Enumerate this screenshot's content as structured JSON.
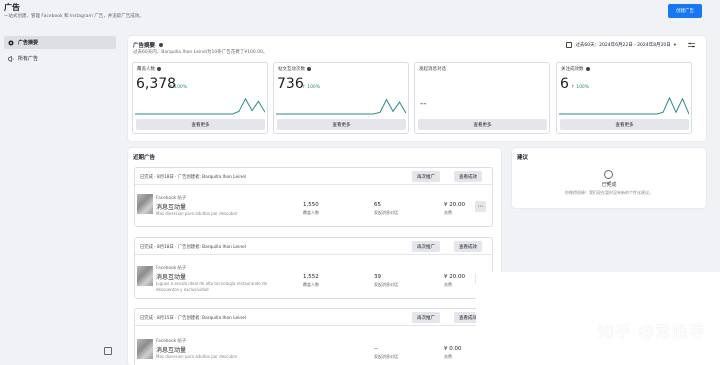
{
  "header": {
    "title": "广告",
    "subtitle": "一站式创建、管理 Facebook 和 Instagram 广告，并追踪广告成效。",
    "create_label": "创建广告"
  },
  "sidebar": {
    "items": [
      {
        "label": "广告摘要",
        "active": true
      },
      {
        "label": "所有广告",
        "active": false
      }
    ]
  },
  "summary": {
    "title": "广告摘要",
    "subtitle": "过去60天内，Barquilla Ihon Leinel为10条广告花费了¥100.00。",
    "date_range": "过去60天：2024年6月22日 - 2024年8月20日",
    "metrics": [
      {
        "label": "覆盖人数",
        "value": "6,378",
        "change": "↑ 100%",
        "button": "查看更多",
        "spark": [
          0,
          0,
          0,
          0,
          0,
          0,
          0,
          0,
          0,
          0,
          0,
          0,
          0,
          0,
          0,
          0,
          0.15,
          0.9,
          0.2,
          0.75,
          0.1
        ]
      },
      {
        "label": "帖文互动次数",
        "value": "736",
        "change": "↑ 100%",
        "button": "查看更多",
        "spark": [
          0,
          0,
          0,
          0,
          0,
          0,
          0,
          0,
          0,
          0,
          0,
          0,
          0,
          0,
          0,
          0,
          0.1,
          0.85,
          0.15,
          0.7,
          0.05
        ]
      },
      {
        "label": "发起消息对话",
        "value": "--",
        "change": "",
        "button": "查看更多",
        "spark": []
      },
      {
        "label": "关注成效数",
        "value": "6",
        "change": "↑ 100%",
        "button": "查看更多",
        "spark": [
          0,
          0,
          0,
          0,
          0,
          0,
          0,
          0,
          0,
          0,
          0,
          0,
          0,
          0,
          0,
          0,
          0.1,
          0.95,
          0.1,
          0.9,
          0.0
        ]
      }
    ]
  },
  "recent": {
    "title": "近期广告",
    "ads": [
      {
        "status": "已完成 · 8月18日 · 广告创建者: Barquilla Ihon Leinel",
        "boost_label": "再次推广",
        "view_label": "查看成效",
        "source": "Facebook 帖子",
        "name": "消息互动量",
        "desc": "Mas diversion para adultos por descubrir",
        "reach": "1,550",
        "reach_label": "覆盖人数",
        "engage": "65",
        "engage_label": "发起消息对话",
        "spend": "¥ 20.00",
        "spend_label": "花费"
      },
      {
        "status": "已完成 · 8月18日 · 广告创建者: Barquilla Ihon Leinel",
        "boost_label": "再次推广",
        "view_label": "查看成效",
        "source": "Facebook 帖子",
        "name": "消息互动量",
        "desc": "Jugues a escala ideal de alta tecnología restaurando de descuentos y exclusividad",
        "reach": "1,552",
        "reach_label": "覆盖人数",
        "engage": "39",
        "engage_label": "发起消息对话",
        "spend": "¥ 20.00",
        "spend_label": "花费"
      },
      {
        "status": "已完成 · 8月15日 · 广告创建者: Barquilla Ihon Leinel",
        "boost_label": "再次推广",
        "view_label": "查看成效",
        "source": "Facebook 帖子",
        "name": "消息互动量",
        "desc": "Mas diversion para adultos por descubrir",
        "reach": "",
        "reach_label": "",
        "engage": "--",
        "engage_label": "发起消息对话",
        "spend": "¥ 0.00",
        "spend_label": "花费"
      }
    ]
  },
  "suggestions": {
    "title": "建议",
    "done": "已完成",
    "note": "你做得很棒！我们现在暂时没有新的个性化建议。"
  },
  "watermark": "知乎 @常指导"
}
